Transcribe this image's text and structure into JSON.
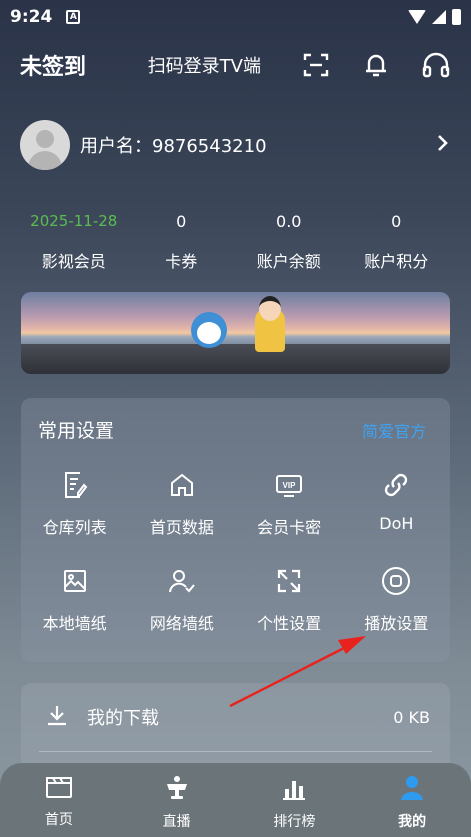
{
  "status_bar": {
    "time": "9:24",
    "notif_letter": "A"
  },
  "header": {
    "title": "未签到",
    "scan_text": "扫码登录TV端",
    "icons": [
      "scan-icon",
      "bell-icon",
      "headset-icon"
    ]
  },
  "user": {
    "username_text": "用户名：9876543210"
  },
  "stats": [
    {
      "value": "2025-11-28",
      "label": "影视会员",
      "accent": "#5cbc52"
    },
    {
      "value": "0",
      "label": "卡券"
    },
    {
      "value": "0.0",
      "label": "账户余额"
    },
    {
      "value": "0",
      "label": "账户积分"
    }
  ],
  "settings": {
    "title": "常用设置",
    "link": "简爱官方",
    "link_color": "#3ea3f5",
    "items": [
      {
        "label": "仓库列表",
        "icon": "edit-document-icon"
      },
      {
        "label": "首页数据",
        "icon": "home-icon"
      },
      {
        "label": "会员卡密",
        "icon": "vip-icon"
      },
      {
        "label": "DoH",
        "icon": "link-icon"
      },
      {
        "label": "本地墙纸",
        "icon": "image-icon"
      },
      {
        "label": "网络墙纸",
        "icon": "user-check-icon"
      },
      {
        "label": "个性设置",
        "icon": "expand-icon"
      },
      {
        "label": "播放设置",
        "icon": "play-circle-icon"
      }
    ]
  },
  "download": {
    "label": "我的下载",
    "size": "0 KB",
    "icon": "download-icon"
  },
  "bottom_nav": [
    {
      "label": "首页",
      "icon": "clapperboard-icon"
    },
    {
      "label": "直播",
      "icon": "trophy-icon"
    },
    {
      "label": "排行榜",
      "icon": "bar-chart-icon"
    },
    {
      "label": "我的",
      "icon": "user-icon",
      "active": true,
      "accent": "#2f9bf0"
    }
  ]
}
